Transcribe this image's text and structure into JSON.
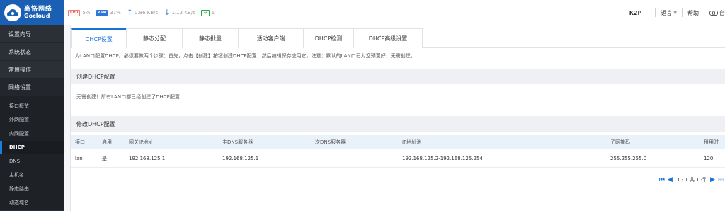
{
  "brand": {
    "name_cn": "高恪网络",
    "name_en": "Gocloud"
  },
  "status": {
    "cpu_chip": "CPU",
    "cpu": "5%",
    "ram_chip": "RAM",
    "ram": "37%",
    "upload": "0.86 KB/s",
    "download": "1.13 KB/s",
    "connections": "1"
  },
  "header": {
    "model": "K2P",
    "language": "语言",
    "help": "帮助",
    "extra": "台"
  },
  "sidebar": {
    "groups": [
      "设置向导",
      "系统状态",
      "常用操作",
      "网络设置"
    ],
    "sub_items": [
      "接口概览",
      "外网配置",
      "内网配置",
      "DHCP",
      "DNS",
      "主机名",
      "静态路由",
      "动态域名"
    ],
    "active": "DHCP"
  },
  "tabs": [
    "DHCP设置",
    "静态分配",
    "静态批量",
    "活动客户端",
    "DHCP检测",
    "DHCP高级设置"
  ],
  "notice": "为LAN口配置DHCP。必须要做两个步骤：首先，点击【创建】按钮创建DHCP配置；然后编辑保存应用它。注意：默认的LAN口已为您预置好，无需创建。",
  "create_panel": {
    "title": "创建DHCP配置",
    "message": "无需创建！所有LAN口都已经创建了DHCP配置！"
  },
  "edit_panel": {
    "title": "修改DHCP配置"
  },
  "table": {
    "columns": [
      "接口",
      "启用",
      "网关IP地址",
      "主DNS服务器",
      "次DNS服务器",
      "IP地址池",
      "子网掩码",
      "租用时"
    ],
    "rows": [
      [
        "lan",
        "是",
        "192.168.125.1",
        "192.168.125.1",
        "",
        "192.168.125.2-192.168.125.254",
        "255.255.255.0",
        "120"
      ]
    ]
  },
  "pager": {
    "text": "1 - 1 共 1 行"
  },
  "colors": {
    "brand": "#1a5fb4",
    "accent": "#1a72d8",
    "sidebar": "#2b2f36"
  }
}
